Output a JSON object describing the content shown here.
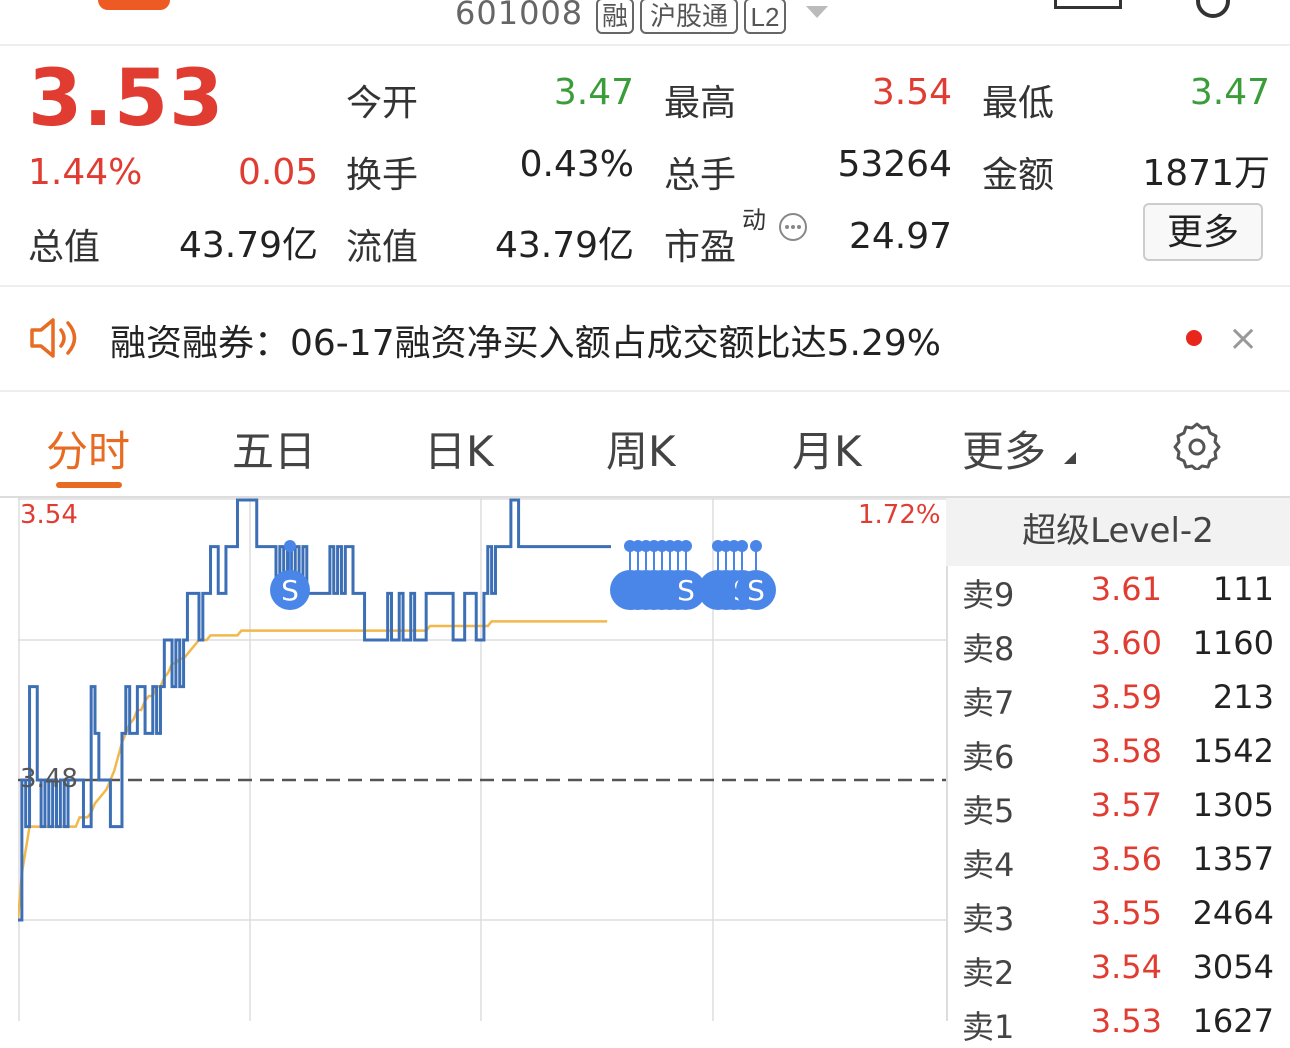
{
  "header": {
    "code": "601008",
    "tags": [
      "融",
      "沪股通",
      "L2"
    ]
  },
  "quote": {
    "price": "3.53",
    "change_pct": "1.44%",
    "change": "0.05",
    "open_label": "今开",
    "open": "3.47",
    "high_label": "最高",
    "high": "3.54",
    "low_label": "最低",
    "low": "3.47",
    "turnover_label": "换手",
    "turnover": "0.43%",
    "volume_label": "总手",
    "volume": "53264",
    "amount_label": "金额",
    "amount": "1871万",
    "mktcap_label": "总值",
    "mktcap": "43.79亿",
    "float_label": "流值",
    "float_cap": "43.79亿",
    "pe_label": "市盈",
    "pe_sup": "动",
    "pe": "24.97",
    "more_button": "更多"
  },
  "notice": {
    "text": "融资融券：06-17融资净买入额占成交额比达5.29%",
    "close_symbol": "×"
  },
  "tabs": [
    "分时",
    "五日",
    "日K",
    "周K",
    "月K",
    "更多"
  ],
  "chart_data": {
    "type": "line",
    "axis_top_price": "3.54",
    "axis_top_pct": "1.72%",
    "reference_price": "3.48",
    "prev_close": 3.48,
    "ylim": [
      3.42,
      3.54
    ],
    "price": [
      3.45,
      3.48,
      3.47,
      3.5,
      3.5,
      3.48,
      3.47,
      3.48,
      3.47,
      3.48,
      3.47,
      3.48,
      3.47,
      3.48,
      3.48,
      3.48,
      3.48,
      3.47,
      3.47,
      3.5,
      3.49,
      3.48,
      3.48,
      3.48,
      3.47,
      3.47,
      3.47,
      3.49,
      3.5,
      3.49,
      3.49,
      3.5,
      3.5,
      3.49,
      3.49,
      3.5,
      3.49,
      3.5,
      3.51,
      3.51,
      3.5,
      3.51,
      3.5,
      3.51,
      3.52,
      3.52,
      3.52,
      3.51,
      3.52,
      3.52,
      3.53,
      3.53,
      3.52,
      3.52,
      3.53,
      3.53,
      3.53,
      3.54,
      3.54,
      3.54,
      3.54,
      3.54,
      3.53,
      3.53,
      3.53,
      3.53,
      3.53,
      3.52,
      3.53,
      3.52,
      3.53,
      3.52,
      3.53,
      3.52,
      3.53,
      3.52,
      3.52,
      3.52,
      3.52,
      3.52,
      3.52,
      3.53,
      3.52,
      3.53,
      3.52,
      3.53,
      3.53,
      3.52,
      3.52,
      3.52,
      3.51,
      3.51,
      3.51,
      3.51,
      3.51,
      3.51,
      3.52,
      3.51,
      3.51,
      3.52,
      3.51,
      3.51,
      3.52,
      3.51,
      3.51,
      3.51,
      3.52,
      3.52,
      3.52,
      3.52,
      3.52,
      3.52,
      3.52,
      3.51,
      3.51,
      3.51,
      3.52,
      3.52,
      3.52,
      3.51,
      3.51,
      3.52,
      3.53,
      3.52,
      3.53,
      3.53,
      3.53,
      3.53,
      3.54,
      3.54,
      3.53,
      3.53,
      3.53,
      3.53,
      3.53,
      3.53,
      3.53,
      3.53,
      3.53,
      3.53,
      3.53,
      3.53,
      3.53,
      3.53,
      3.53,
      3.53,
      3.53,
      3.53,
      3.53,
      3.53,
      3.53,
      3.53,
      3.53,
      3.53,
      3.53
    ],
    "avg_price": [
      3.45,
      3.46,
      3.465,
      3.47,
      3.47,
      3.47,
      3.47,
      3.47,
      3.47,
      3.47,
      3.47,
      3.47,
      3.47,
      3.47,
      3.47,
      3.47,
      3.472,
      3.472,
      3.472,
      3.473,
      3.475,
      3.476,
      3.477,
      3.478,
      3.48,
      3.482,
      3.485,
      3.488,
      3.49,
      3.492,
      3.493,
      3.495,
      3.495,
      3.497,
      3.498,
      3.498,
      3.5,
      3.5,
      3.502,
      3.503,
      3.505,
      3.505,
      3.506,
      3.506,
      3.507,
      3.508,
      3.509,
      3.51,
      3.51,
      3.51,
      3.511,
      3.511,
      3.511,
      3.511,
      3.511,
      3.511,
      3.511,
      3.511,
      3.512,
      3.512,
      3.512,
      3.512,
      3.512,
      3.512,
      3.512,
      3.512,
      3.512,
      3.512,
      3.512,
      3.512,
      3.512,
      3.512,
      3.512,
      3.512,
      3.512,
      3.512,
      3.512,
      3.512,
      3.512,
      3.512,
      3.512,
      3.512,
      3.512,
      3.512,
      3.512,
      3.512,
      3.512,
      3.512,
      3.512,
      3.512,
      3.512,
      3.512,
      3.512,
      3.512,
      3.512,
      3.512,
      3.512,
      3.512,
      3.512,
      3.512,
      3.512,
      3.512,
      3.512,
      3.512,
      3.512,
      3.512,
      3.512,
      3.513,
      3.513,
      3.513,
      3.513,
      3.513,
      3.513,
      3.513,
      3.513,
      3.513,
      3.513,
      3.513,
      3.513,
      3.513,
      3.513,
      3.513,
      3.513,
      3.514,
      3.514,
      3.514,
      3.514,
      3.514,
      3.514,
      3.514,
      3.514,
      3.514,
      3.514,
      3.514,
      3.514,
      3.514,
      3.514,
      3.514,
      3.514,
      3.514,
      3.514,
      3.514,
      3.514,
      3.514,
      3.514,
      3.514,
      3.514,
      3.514,
      3.514,
      3.514,
      3.514,
      3.514,
      3.514,
      3.514
    ],
    "markers": [
      "S",
      "S",
      "S",
      "S",
      "S",
      "S",
      "S",
      "S",
      "S",
      "S",
      "S",
      "S",
      "S",
      "S"
    ]
  },
  "level2": {
    "title": "超级Level-2",
    "asks": [
      {
        "label": "卖9",
        "price": "3.61",
        "volume": "111"
      },
      {
        "label": "卖8",
        "price": "3.60",
        "volume": "1160"
      },
      {
        "label": "卖7",
        "price": "3.59",
        "volume": "213"
      },
      {
        "label": "卖6",
        "price": "3.58",
        "volume": "1542"
      },
      {
        "label": "卖5",
        "price": "3.57",
        "volume": "1305"
      },
      {
        "label": "卖4",
        "price": "3.56",
        "volume": "1357"
      },
      {
        "label": "卖3",
        "price": "3.55",
        "volume": "2464"
      },
      {
        "label": "卖2",
        "price": "3.54",
        "volume": "3054"
      },
      {
        "label": "卖1",
        "price": "3.53",
        "volume": "1627"
      }
    ]
  },
  "colors": {
    "up": "#e03c31",
    "down": "#3a9d3a",
    "accent": "#e86b24",
    "price_line": "#3c6fb6",
    "avg_line": "#f2b84b",
    "marker": "#4a86e8"
  }
}
